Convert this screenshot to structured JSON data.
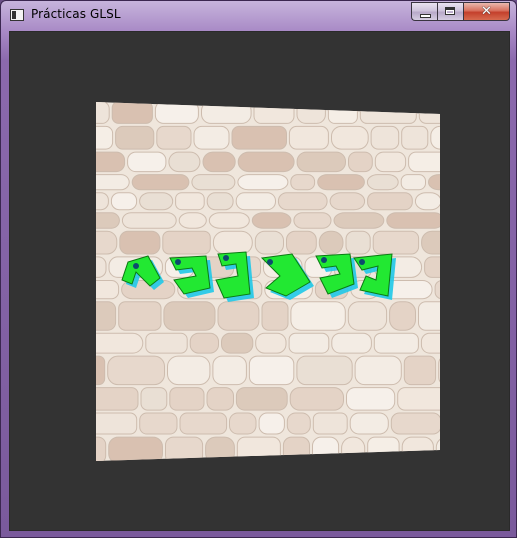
{
  "window": {
    "title": "Prácticas GLSL",
    "icon": "app-window-icon",
    "controls": {
      "minimize_icon": "minimize-icon",
      "maximize_icon": "maximize-icon",
      "close_icon": "close-icon",
      "close_glyph": "✕"
    }
  },
  "viewport": {
    "background_color": "#333333",
    "quad_texture": "stone-wall",
    "overlay_texture": "green-cyan-3d-glyphs",
    "colors": {
      "stone_base": "#e8ddd2",
      "stone_mortar": "#d9cfc4",
      "glyph_green": "#22e832",
      "glyph_cyan": "#1fc8e8"
    }
  }
}
